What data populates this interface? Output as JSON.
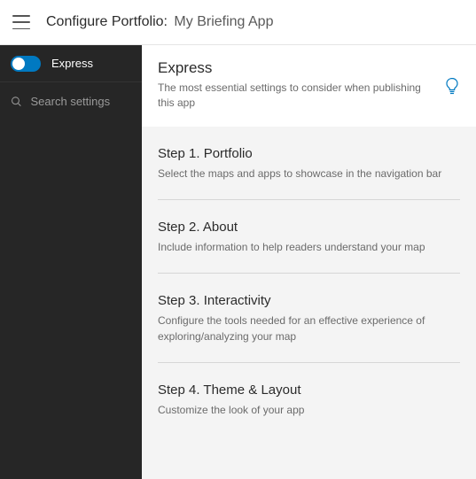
{
  "header": {
    "title_prefix": "Configure Portfolio:",
    "title_value": "My Briefing App"
  },
  "sidebar": {
    "toggle_label": "Express",
    "search_placeholder": "Search settings"
  },
  "intro": {
    "title": "Express",
    "description": "The most essential settings to consider when publishing this app"
  },
  "steps": [
    {
      "heading": "Step 1. Portfolio",
      "description": "Select the maps and apps to showcase in the navigation bar"
    },
    {
      "heading": "Step 2. About",
      "description": "Include information to help readers understand your map"
    },
    {
      "heading": "Step 3. Interactivity",
      "description": "Configure the tools needed for an effective experience of exploring/analyzing your map"
    },
    {
      "heading": "Step 4. Theme & Layout",
      "description": "Customize the look of your app"
    }
  ]
}
